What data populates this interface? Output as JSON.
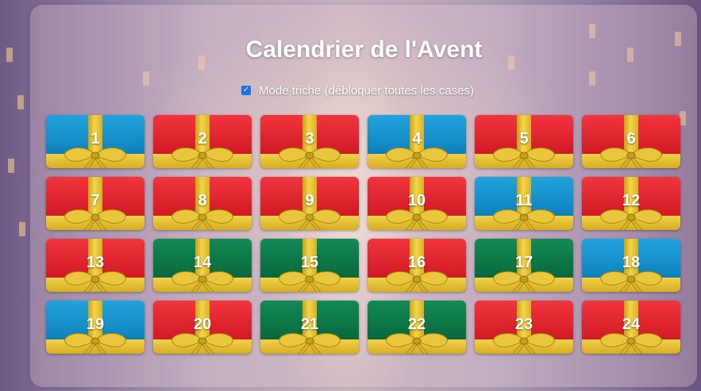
{
  "page": {
    "title": "Calendrier de l'Avent",
    "cheat_label": "Mode triche (débloquer toutes les cases)",
    "cheat_checked": true
  },
  "colors": {
    "red": "#d81e28",
    "blue": "#1188c3",
    "green": "#0a6e41",
    "ribbon": "#e5c236"
  },
  "days": [
    {
      "label": "1",
      "color": "blue"
    },
    {
      "label": "2",
      "color": "red"
    },
    {
      "label": "3",
      "color": "red"
    },
    {
      "label": "4",
      "color": "blue"
    },
    {
      "label": "5",
      "color": "red"
    },
    {
      "label": "6",
      "color": "red"
    },
    {
      "label": "7",
      "color": "red"
    },
    {
      "label": "8",
      "color": "red"
    },
    {
      "label": "9",
      "color": "red"
    },
    {
      "label": "10",
      "color": "red"
    },
    {
      "label": "11",
      "color": "blue"
    },
    {
      "label": "12",
      "color": "red"
    },
    {
      "label": "13",
      "color": "red"
    },
    {
      "label": "14",
      "color": "green"
    },
    {
      "label": "15",
      "color": "green"
    },
    {
      "label": "16",
      "color": "red"
    },
    {
      "label": "17",
      "color": "green"
    },
    {
      "label": "18",
      "color": "blue"
    },
    {
      "label": "19",
      "color": "blue"
    },
    {
      "label": "20",
      "color": "red"
    },
    {
      "label": "21",
      "color": "green"
    },
    {
      "label": "22",
      "color": "green"
    },
    {
      "label": "23",
      "color": "red"
    },
    {
      "label": "24",
      "color": "red"
    }
  ]
}
